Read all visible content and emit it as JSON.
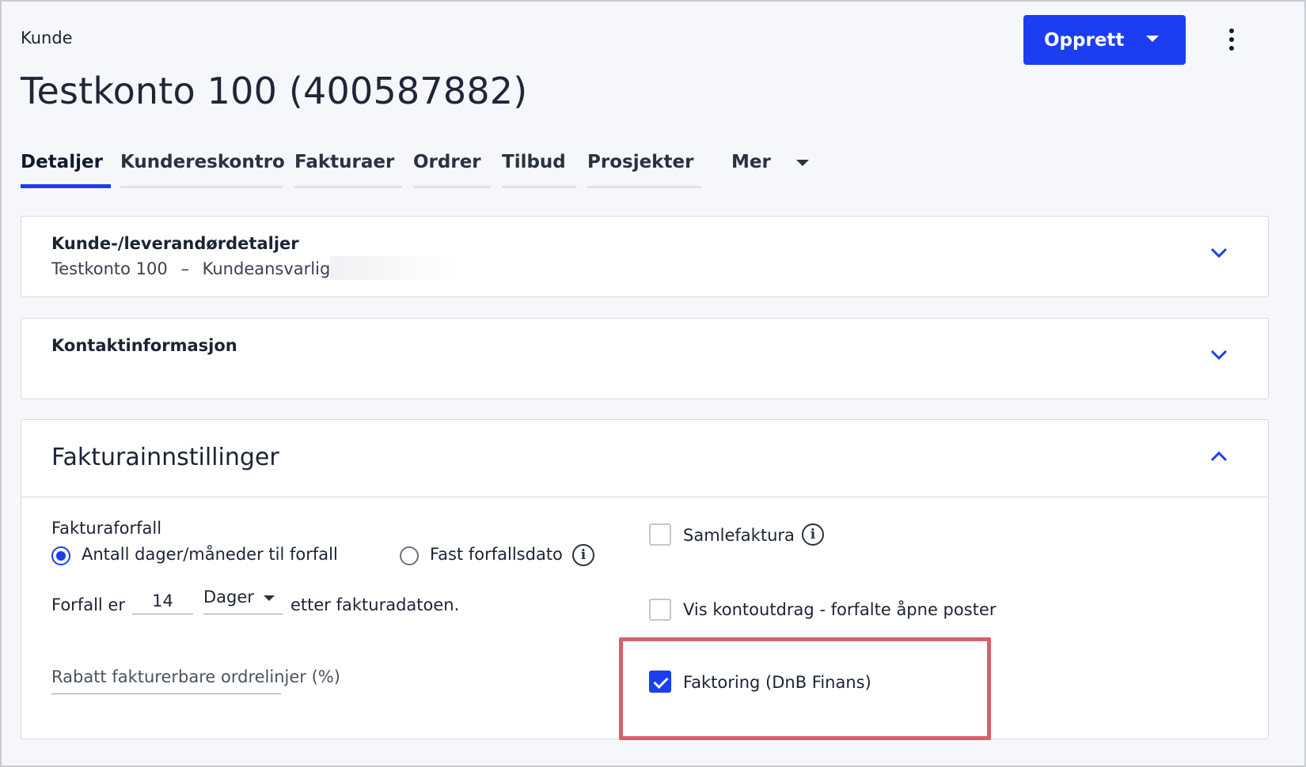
{
  "breadcrumb": "Kunde",
  "page_title": "Testkonto 100 (400587882)",
  "create_button": {
    "label": "Opprett"
  },
  "tabs": [
    {
      "label": "Detaljer",
      "active": true
    },
    {
      "label": "Kundereskontro"
    },
    {
      "label": "Fakturaer"
    },
    {
      "label": "Ordrer"
    },
    {
      "label": "Tilbud"
    },
    {
      "label": "Prosjekter"
    },
    {
      "label": "Mer"
    }
  ],
  "cards": {
    "customer_details": {
      "title": "Kunde-/leverandørdetaljer",
      "name": "Testkonto 100",
      "separator": "–",
      "responsible_label": "Kundeansvarlig"
    },
    "contact": {
      "title": "Kontaktinformasjon"
    },
    "invoice_settings": {
      "title": "Fakturainnstillinger",
      "due_label": "Fakturaforfall",
      "radio_days": {
        "label": "Antall dager/måneder til forfall",
        "checked": true
      },
      "radio_fixed": {
        "label": "Fast forfallsdato",
        "checked": false
      },
      "due_prefix": "Forfall er",
      "due_value": "14",
      "due_unit": "Dager",
      "due_suffix": "etter fakturadatoen.",
      "discount_label": "Rabatt fakturerbare ordrelinjer (%)",
      "collective_invoice": {
        "label": "Samlefaktura",
        "checked": false
      },
      "account_statement": {
        "label": "Vis kontoutdrag - forfalte åpne poster",
        "checked": false
      },
      "factoring": {
        "label": "Faktoring (DnB Finans)",
        "checked": true
      }
    }
  },
  "colors": {
    "accent": "#1b3ef0",
    "highlight": "#d9606b"
  }
}
